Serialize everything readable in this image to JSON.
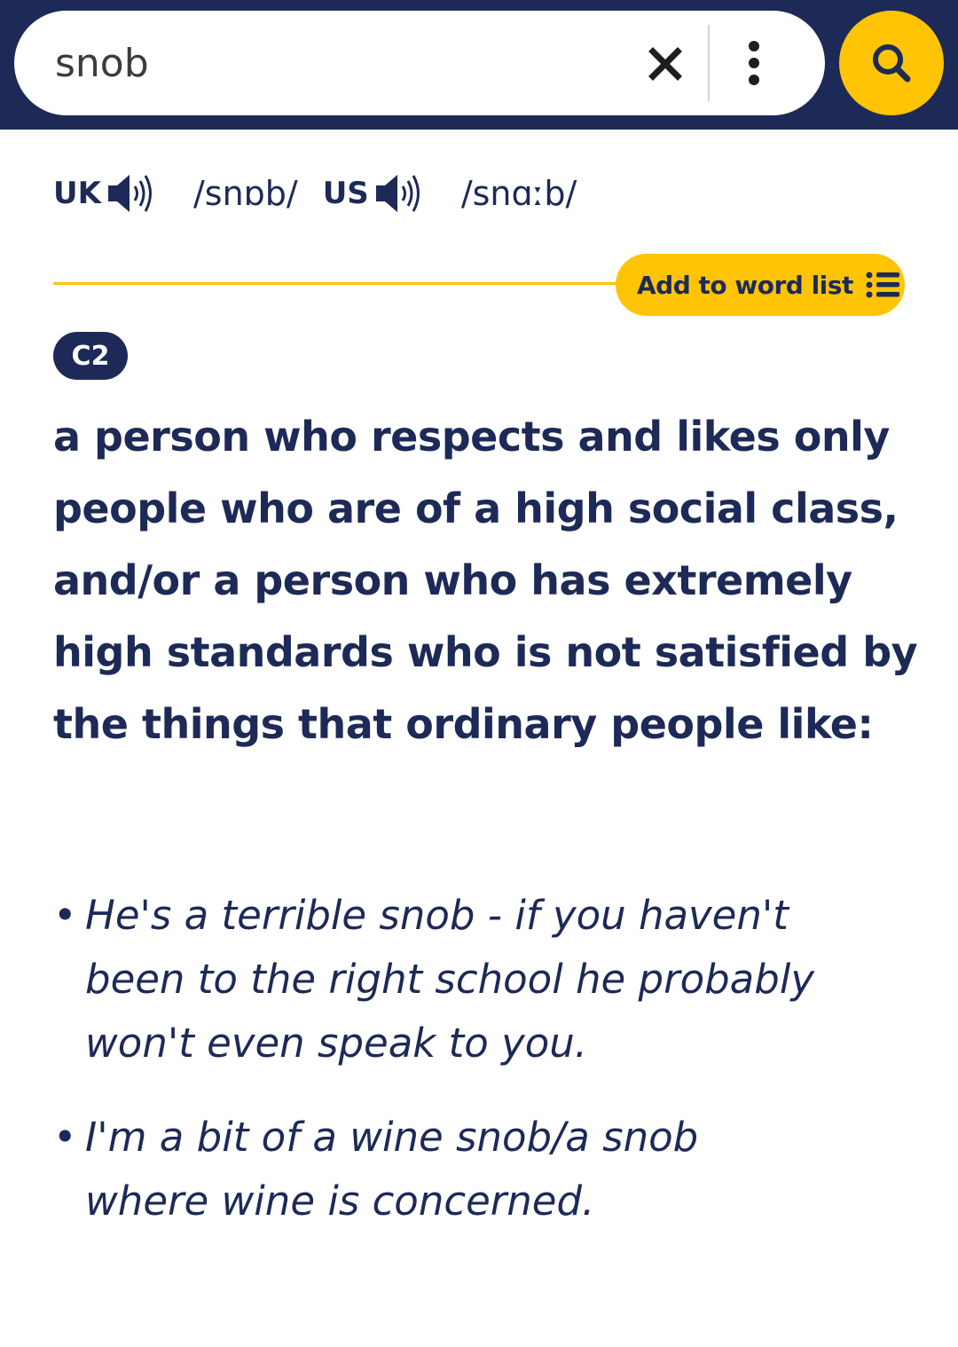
{
  "search": {
    "query": "snob"
  },
  "pronunciation": {
    "uk_label": "UK",
    "uk_ipa": "/snɒb/",
    "us_label": "US",
    "us_ipa": "/snɑːb/"
  },
  "word_list_button": {
    "label": "Add to word list"
  },
  "entry": {
    "level": "C2",
    "definition": "a person who respects and likes only people who are of a high social class, and/or a person who has extremely high standards who is not satisfied by the things that ordinary people like:",
    "examples": [
      "He's a terrible snob - if you haven't been to the right school he probably won't even speak to you.",
      "I'm a bit of a wine snob/a snob where wine is concerned."
    ],
    "bullet": "•"
  },
  "colors": {
    "navy": "#1d2a57",
    "accent_yellow": "#ffc406",
    "background": "#ffffff"
  },
  "icons": [
    "close-icon",
    "more-vert-icon",
    "search-icon",
    "speaker-icon",
    "list-icon"
  ]
}
